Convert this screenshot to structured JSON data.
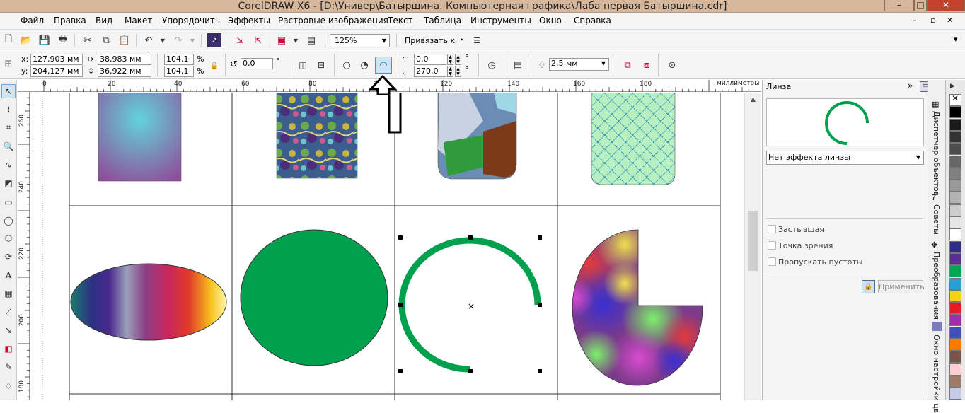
{
  "window": {
    "title": "CorelDRAW X6 - [D:\\Универ\\Батыршина. Компьютерная графика\\Лаба первая Батыршина.cdr]"
  },
  "menu": [
    "Файл",
    "Правка",
    "Вид",
    "Макет",
    "Упорядочить",
    "Эффекты",
    "Растровые изображения",
    "Текст",
    "Таблица",
    "Инструменты",
    "Окно",
    "Справка"
  ],
  "toolbar": {
    "zoom": "125%",
    "snap_label": "Привязать к"
  },
  "propbar": {
    "x_label": "x:",
    "x": "127,903 мм",
    "y_label": "y:",
    "y": "204,127 мм",
    "width": "38,983 мм",
    "height": "36,922 мм",
    "scale_x": "104,1",
    "scale_y": "104,1",
    "pct": "%",
    "rotation": "0,0",
    "deg": "°",
    "start_angle": "0,0",
    "end_angle": "270,0",
    "outline": "2,5 мм"
  },
  "ruler": {
    "h_ticks": [
      "0",
      "20",
      "40",
      "60",
      "80",
      "100",
      "120",
      "140",
      "160",
      "180"
    ],
    "unit": "миллиметры",
    "v_ticks": [
      "260",
      "240",
      "220",
      "200",
      "180"
    ]
  },
  "docker": {
    "title": "Линза",
    "lens_effect": "Нет эффекта линзы",
    "frozen": "Застывшая",
    "viewpoint": "Точка зрения",
    "remove_face": "Пропускать пустоты",
    "apply": "Применить"
  },
  "docker_tabs": [
    "Диспетчер объектов",
    "Советы",
    "Преобразования",
    "Окно настройки цв"
  ],
  "palette": [
    "#ffffff",
    "#000000",
    "#1a1a1a",
    "#333333",
    "#4d4d4d",
    "#666666",
    "#808080",
    "#999999",
    "#b3b3b3",
    "#cccccc",
    "#e6e6e6",
    "#ffffff",
    "#2e2e8a",
    "#5a2d91",
    "#00a651",
    "#2a9fd6",
    "#f7d117",
    "#e51c23",
    "#9b2fae",
    "#3f51b5",
    "#f57c00",
    "#795548",
    "#ffcdd2",
    "#9e7b65",
    "#c5cae9"
  ]
}
